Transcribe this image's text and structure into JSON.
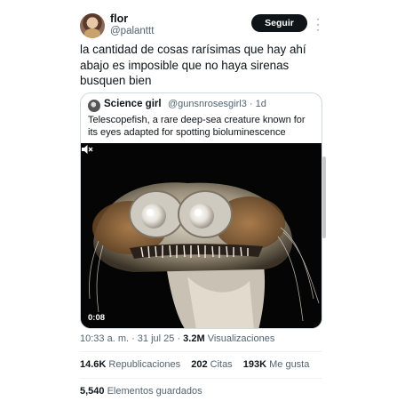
{
  "author": {
    "name": "flor",
    "handle": "@palanttt",
    "follow_label": "Seguir",
    "avatar_icon": "profile-photo"
  },
  "tweet": {
    "text": "la cantidad de cosas rarísimas que hay ahí abajo es imposible que no haya sirenas busquen bien"
  },
  "quote": {
    "name": "Science girl",
    "handle": "@gunsnrosesgirl3 · 1d",
    "text": "Telescopefish, a rare deep-sea creature known for its eyes adapted for spotting bioluminescence",
    "video": {
      "duration": "0:08",
      "volume_icon": "muted-speaker-icon"
    }
  },
  "meta": {
    "time": "10:33 a. m. · 31 jul 25 · ",
    "views_count": "3.2M",
    "views_label": "Visualizaciones"
  },
  "stats": {
    "reposts_count": "14.6K",
    "reposts_label": "Republicaciones",
    "quotes_count": "202",
    "quotes_label": "Citas",
    "likes_count": "193K",
    "likes_label": "Me gusta"
  },
  "bookmarks": {
    "count": "5,540",
    "label": "Elementos guardados"
  },
  "colors": {
    "text": "#0f1419",
    "secondary": "#536471",
    "border": "#cfd9de",
    "button": "#0f1419"
  }
}
